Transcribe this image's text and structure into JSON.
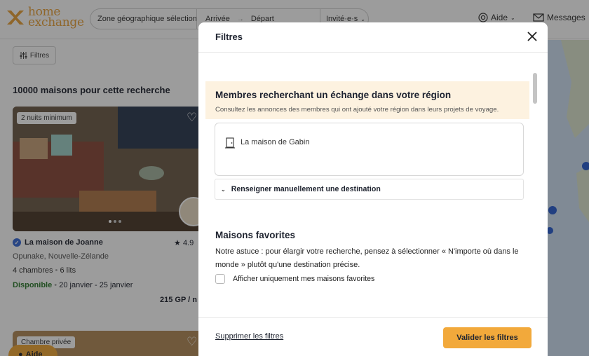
{
  "header": {
    "logo_text_line1": "home",
    "logo_text_line2": "exchange",
    "search": {
      "zone_placeholder": "Zone géographique sélection",
      "arrival_label": "Arrivée",
      "departure_label": "Départ",
      "guests_label": "Invité·e·s"
    },
    "help_label": "Aide",
    "messages_label": "Messages"
  },
  "listing": {
    "filters_button_label": "Filtres",
    "results_title": "10000 maisons pour cette recherche",
    "card": {
      "badge": "2 nuits minimum",
      "title": "La maison de Joanne",
      "rating": "4.9",
      "location": "Opunake, Nouvelle-Zélande",
      "rooms": "4 chambres",
      "beds": "6 lits",
      "availability_label": "Disponible",
      "availability_dates": "20 janvier - 25 janvier",
      "price": "215 GP / n"
    },
    "card2": {
      "badge": "Chambre privée"
    },
    "help_fab_label": "Aide"
  },
  "modal": {
    "title": "Filtres",
    "region_section": {
      "title": "Membres recherchant un échange dans votre région",
      "subtitle": "Consultez les annonces des membres qui ont ajouté votre région dans leurs projets de voyage.",
      "house_name": "La maison de Gabin",
      "manual_destination_label": "Renseigner manuellement une destination"
    },
    "favorites_section": {
      "title": "Maisons favorites",
      "tip": "Notre astuce : pour élargir votre recherche, pensez à sélectionner « N'importe où dans le monde » plutôt qu'une destination précise.",
      "checkbox_label": "Afficher uniquement mes maisons favorites",
      "checkbox_checked": false
    },
    "footer": {
      "clear_label": "Supprimer les filtres",
      "apply_label": "Valider les filtres"
    }
  },
  "colors": {
    "brand": "#e9a23b",
    "apply_button": "#f2a93b",
    "region_highlight": "#fdf2e0",
    "available_green": "#2d7a2d"
  }
}
